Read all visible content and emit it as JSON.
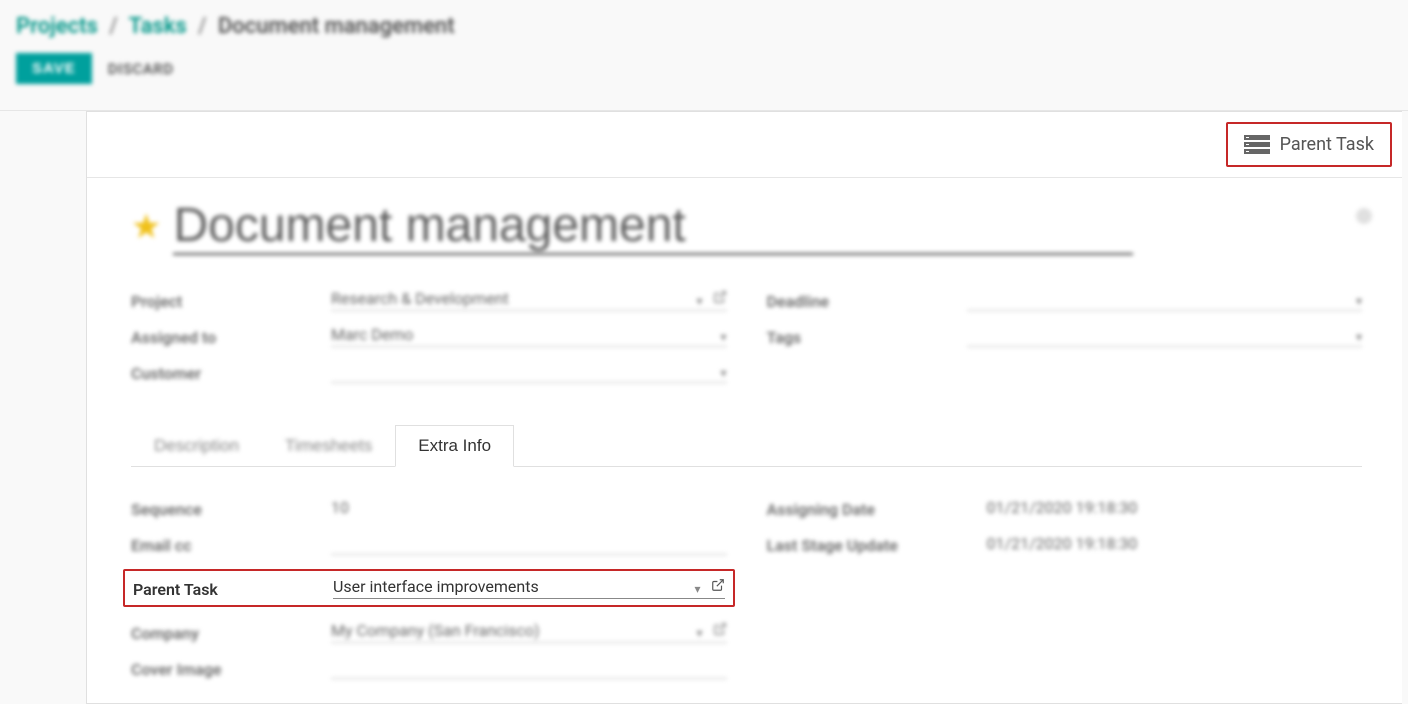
{
  "breadcrumb": {
    "projects": "Projects",
    "tasks": "Tasks",
    "current": "Document management"
  },
  "buttons": {
    "save": "SAVE",
    "discard": "DISCARD",
    "parent_task": "Parent Task"
  },
  "title": "Document management",
  "left": {
    "project_label": "Project",
    "project_value": "Research & Development",
    "assigned_label": "Assigned to",
    "assigned_value": "Marc Demo",
    "customer_label": "Customer",
    "customer_value": ""
  },
  "right": {
    "deadline_label": "Deadline",
    "deadline_value": "",
    "tags_label": "Tags",
    "tags_value": ""
  },
  "tabs": {
    "description": "Description",
    "timesheets": "Timesheets",
    "extra": "Extra Info"
  },
  "extra_left": {
    "sequence_label": "Sequence",
    "sequence_value": "10",
    "email_cc_label": "Email cc",
    "email_cc_value": "",
    "parent_label": "Parent Task",
    "parent_value": "User interface improvements",
    "company_label": "Company",
    "company_value": "My Company (San Francisco)",
    "cover_label": "Cover Image"
  },
  "extra_right": {
    "assigning_label": "Assigning Date",
    "assigning_value": "01/21/2020 19:18:30",
    "last_stage_label": "Last Stage Update",
    "last_stage_value": "01/21/2020 19:18:30"
  }
}
